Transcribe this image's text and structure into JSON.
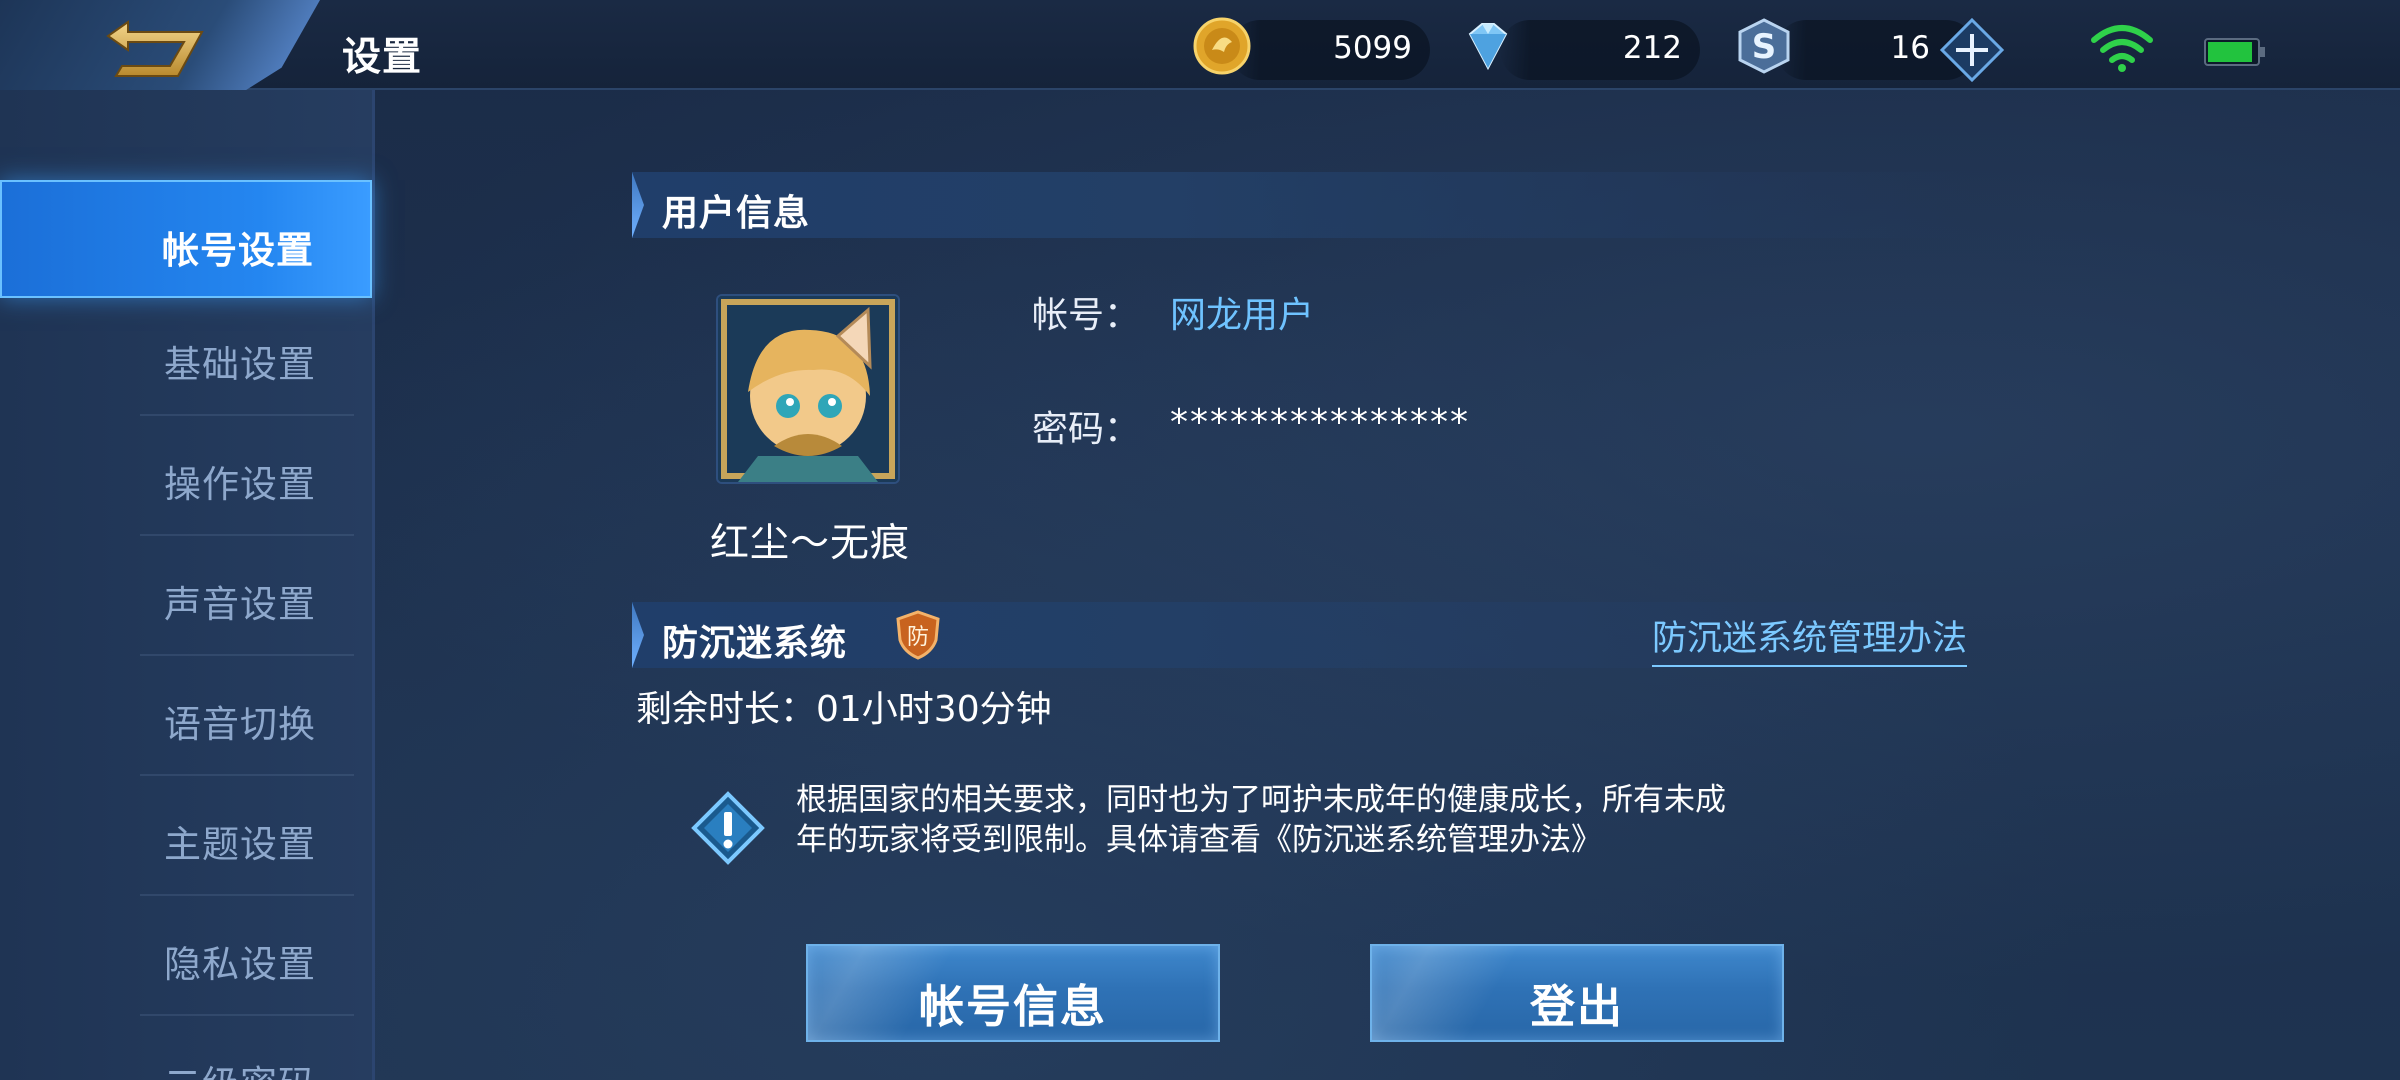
{
  "header": {
    "title": "设置",
    "gold": "5099",
    "diamonds": "212",
    "vouchers": "16"
  },
  "sidebar": {
    "items": [
      {
        "label": "帐号设置",
        "active": true
      },
      {
        "label": "基础设置"
      },
      {
        "label": "操作设置"
      },
      {
        "label": "声音设置"
      },
      {
        "label": "语音切换"
      },
      {
        "label": "主题设置"
      },
      {
        "label": "隐私设置"
      },
      {
        "label": "二级密码"
      }
    ]
  },
  "user_info": {
    "section_title": "用户信息",
    "nickname": "红尘～无痕",
    "account_label": "帐号：",
    "account_value": "网龙用户",
    "password_label": "密码：",
    "password_value": "***************"
  },
  "anti_addiction": {
    "section_title": "防沉迷系统",
    "badge": "防",
    "policy_link": "防沉迷系统管理办法",
    "remaining": "剩余时长：01小时30分钟",
    "notice_line1": "根据国家的相关要求，同时也为了呵护未成年的健康成长，所有未成",
    "notice_line2": "年的玩家将受到限制。具体请查看《防沉迷系统管理办法》"
  },
  "buttons": {
    "account_info": "帐号信息",
    "logout": "登出"
  },
  "colors": {
    "accent_blue": "#2486f0",
    "link_blue": "#7cc9ff",
    "background": "#1c2f4c"
  }
}
